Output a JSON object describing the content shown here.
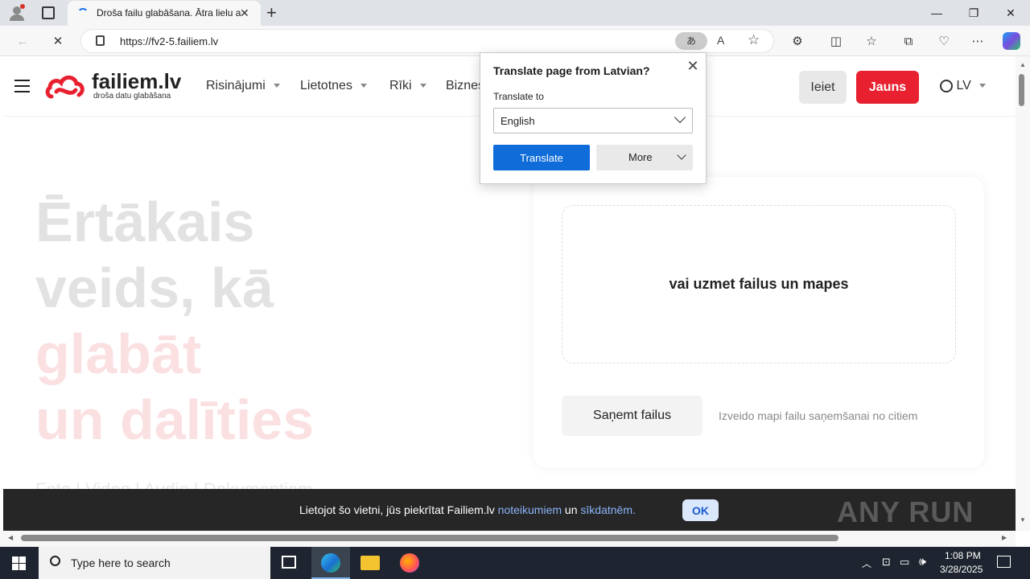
{
  "browser": {
    "tab_title": "Droša failu glabāšana. Ātra lielu a",
    "url": "https://fv2-5.failiem.lv"
  },
  "site": {
    "logo_name": "failiem.lv",
    "logo_tagline": "droša datu glabāšana",
    "nav": [
      "Risinājumi",
      "Lietotnes",
      "Rīki",
      "Biznes"
    ],
    "login": "Ieiet",
    "register": "Jauns",
    "language": "LV"
  },
  "hero": {
    "line1": "Ērtākais",
    "line2": "veids, kā",
    "line3": "glabāt",
    "line4": "un dalīties",
    "sub": "Foto | Video | Audio | Dokumentiem"
  },
  "upload": {
    "drop_text": "vai uzmet failus un mapes",
    "receive_button": "Saņemt failus",
    "receive_hint": "Izveido mapi failu saņemšanai no citiem"
  },
  "cookie": {
    "text_before": "Lietojot šo vietni, jūs piekrītat Failiem.lv",
    "link_terms": "noteikumiem",
    "text_mid": "un",
    "link_cookies": "sīkdatnēm.",
    "ok": "OK",
    "watermark": "ANY RUN"
  },
  "translate_popup": {
    "title": "Translate page from Latvian?",
    "label": "Translate to",
    "language": "English",
    "translate_button": "Translate",
    "more_button": "More"
  },
  "taskbar": {
    "search_placeholder": "Type here to search",
    "time": "1:08 PM",
    "date": "3/28/2025"
  },
  "colors": {
    "brand_red": "#e8202f",
    "translate_blue": "#0f6cd8"
  }
}
